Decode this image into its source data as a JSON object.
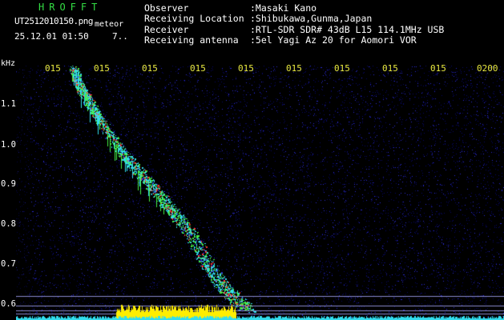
{
  "header": {
    "app_title": "HROFFT",
    "file_name": "UT2512010150.png",
    "meteor_tag": "meteor",
    "timestamp": "25.12.01 01:50",
    "counter": "7..",
    "info": [
      {
        "label": "Observer",
        "value": ":Masaki Kano"
      },
      {
        "label": "Receiving Location",
        "value": ":Shibukawa,Gunma,Japan"
      },
      {
        "label": "Receiver",
        "value": ":RTL-SDR SDR# 43dB L15 114.1MHz USB"
      },
      {
        "label": "Receiving antenna",
        "value": ":5el Yagi Az 20 for Aomori VOR"
      }
    ]
  },
  "axis": {
    "freq_unit": "kHz",
    "freq_ticks": [
      {
        "label": "1.1",
        "value": 1.1
      },
      {
        "label": "1.0",
        "value": 1.0
      },
      {
        "label": "0.9",
        "value": 0.9
      },
      {
        "label": "0.8",
        "value": 0.8
      },
      {
        "label": "0.7",
        "value": 0.7
      },
      {
        "label": "0.6",
        "value": 0.6
      }
    ],
    "time_ticks": [
      "015",
      "015",
      "015",
      "015",
      "015",
      "015",
      "015",
      "015",
      "015",
      "0200"
    ]
  },
  "colors": {
    "background": "#000000",
    "noise_dark": "#0a0a66",
    "noise_light": "#2a2ad0",
    "trail_cyan": "#33ddee",
    "trail_green": "#44ee44",
    "trail_red": "#ff3333",
    "baseline": "#ffee00",
    "guide_line": "#8888cc",
    "title_green": "#33dd44",
    "tick_yellow": "#e8e840"
  }
}
